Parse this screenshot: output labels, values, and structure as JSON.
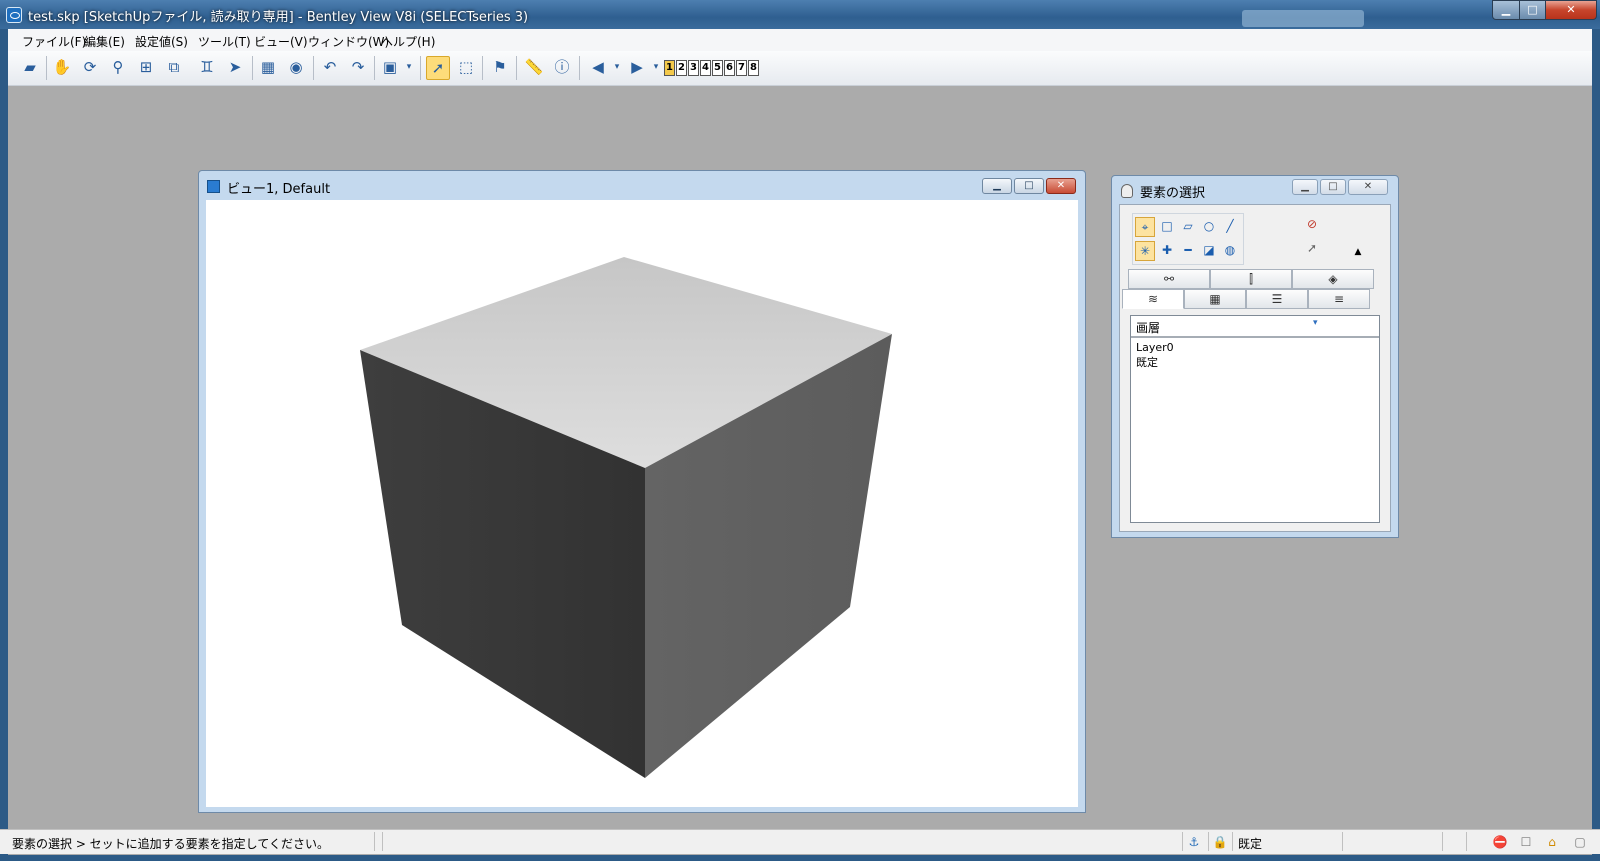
{
  "app": {
    "title": "test.skp [SketchUpファイル, 読み取り専用] - Bentley View V8i (SELECTseries 3)"
  },
  "window_controls": {
    "minimize": "▁",
    "maximize": "□",
    "close": "✕"
  },
  "menu": [
    {
      "id": "file",
      "label": "ファイル(F)"
    },
    {
      "id": "edit",
      "label": "編集(E)"
    },
    {
      "id": "settings",
      "label": "設定値(S)"
    },
    {
      "id": "tools",
      "label": "ツール(T)"
    },
    {
      "id": "view",
      "label": "ビュー(V)"
    },
    {
      "id": "window",
      "label": "ウィンドウ(W)"
    },
    {
      "id": "help",
      "label": "ヘルプ(H)"
    }
  ],
  "toolbar": {
    "icons": [
      {
        "name": "open-folder-icon",
        "glyph": "▰"
      },
      {
        "name": "pan-hand-icon",
        "glyph": "✋"
      },
      {
        "name": "rotate-view-icon",
        "glyph": "⟳"
      },
      {
        "name": "zoom-icon",
        "glyph": "⚲"
      },
      {
        "name": "fit-view-icon",
        "glyph": "⊞"
      },
      {
        "name": "window-area-icon",
        "glyph": "⧉"
      },
      {
        "name": "walk-icon",
        "glyph": "♊"
      },
      {
        "name": "fly-icon",
        "glyph": "➤"
      },
      {
        "name": "camera-icon",
        "glyph": "▦"
      },
      {
        "name": "render-icon",
        "glyph": "◉"
      },
      {
        "name": "previous-view-icon",
        "glyph": "↶"
      },
      {
        "name": "next-view-icon",
        "glyph": "↷"
      },
      {
        "name": "view-attributes-icon",
        "glyph": "▣"
      },
      {
        "name": "select-arrow-icon",
        "glyph": "➚"
      },
      {
        "name": "fence-icon",
        "glyph": "⬚"
      },
      {
        "name": "analyze-icon",
        "glyph": "⚑"
      },
      {
        "name": "measure-icon",
        "glyph": "📏"
      },
      {
        "name": "info-icon",
        "glyph": "ⓘ"
      },
      {
        "name": "back-icon",
        "glyph": "◀"
      },
      {
        "name": "forward-icon",
        "glyph": "▶"
      }
    ],
    "dropdown_glyph": "▾",
    "view_numbers": [
      "1",
      "2",
      "3",
      "4",
      "5",
      "6",
      "7",
      "8"
    ]
  },
  "view_window": {
    "title": "ビュー1, Default",
    "cube_colors": {
      "top": "#d2d2d2",
      "left": "#383838",
      "right": "#6a6a6a"
    }
  },
  "selection_panel": {
    "title": "要素の選択",
    "mode_icons_row1": [
      "⌖",
      "□",
      "▱",
      "○",
      "╱"
    ],
    "mode_icons_row2": [
      "✳",
      "✚",
      "━",
      "◪",
      "◍"
    ],
    "side_icons": [
      "⊘",
      "➚",
      "▲"
    ],
    "tabs_row1": [
      "⚯",
      "⫿",
      "◈"
    ],
    "tabs_row2": [
      "≋",
      "▦",
      "☰",
      "≡"
    ],
    "list_header": "画層",
    "list_rows": [
      "Layer0",
      "既定"
    ]
  },
  "status": {
    "prompt": "要素の選択 > セットに追加する要素を指定してください。",
    "level": "既定",
    "icons": [
      "⚓",
      "🔒",
      "⛔",
      "☐",
      "⌂",
      "▢"
    ]
  }
}
